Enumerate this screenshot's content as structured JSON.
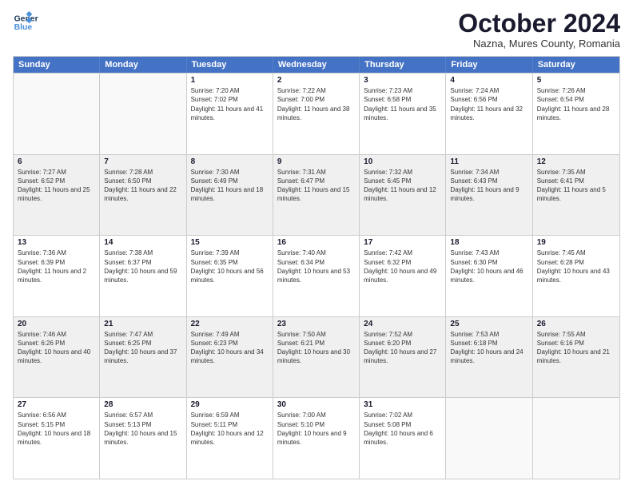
{
  "header": {
    "logo_line1": "General",
    "logo_line2": "Blue",
    "month": "October 2024",
    "location": "Nazna, Mures County, Romania"
  },
  "days_of_week": [
    "Sunday",
    "Monday",
    "Tuesday",
    "Wednesday",
    "Thursday",
    "Friday",
    "Saturday"
  ],
  "weeks": [
    [
      {
        "day": "",
        "info": ""
      },
      {
        "day": "",
        "info": ""
      },
      {
        "day": "1",
        "info": "Sunrise: 7:20 AM\nSunset: 7:02 PM\nDaylight: 11 hours and 41 minutes."
      },
      {
        "day": "2",
        "info": "Sunrise: 7:22 AM\nSunset: 7:00 PM\nDaylight: 11 hours and 38 minutes."
      },
      {
        "day": "3",
        "info": "Sunrise: 7:23 AM\nSunset: 6:58 PM\nDaylight: 11 hours and 35 minutes."
      },
      {
        "day": "4",
        "info": "Sunrise: 7:24 AM\nSunset: 6:56 PM\nDaylight: 11 hours and 32 minutes."
      },
      {
        "day": "5",
        "info": "Sunrise: 7:26 AM\nSunset: 6:54 PM\nDaylight: 11 hours and 28 minutes."
      }
    ],
    [
      {
        "day": "6",
        "info": "Sunrise: 7:27 AM\nSunset: 6:52 PM\nDaylight: 11 hours and 25 minutes."
      },
      {
        "day": "7",
        "info": "Sunrise: 7:28 AM\nSunset: 6:50 PM\nDaylight: 11 hours and 22 minutes."
      },
      {
        "day": "8",
        "info": "Sunrise: 7:30 AM\nSunset: 6:49 PM\nDaylight: 11 hours and 18 minutes."
      },
      {
        "day": "9",
        "info": "Sunrise: 7:31 AM\nSunset: 6:47 PM\nDaylight: 11 hours and 15 minutes."
      },
      {
        "day": "10",
        "info": "Sunrise: 7:32 AM\nSunset: 6:45 PM\nDaylight: 11 hours and 12 minutes."
      },
      {
        "day": "11",
        "info": "Sunrise: 7:34 AM\nSunset: 6:43 PM\nDaylight: 11 hours and 9 minutes."
      },
      {
        "day": "12",
        "info": "Sunrise: 7:35 AM\nSunset: 6:41 PM\nDaylight: 11 hours and 5 minutes."
      }
    ],
    [
      {
        "day": "13",
        "info": "Sunrise: 7:36 AM\nSunset: 6:39 PM\nDaylight: 11 hours and 2 minutes."
      },
      {
        "day": "14",
        "info": "Sunrise: 7:38 AM\nSunset: 6:37 PM\nDaylight: 10 hours and 59 minutes."
      },
      {
        "day": "15",
        "info": "Sunrise: 7:39 AM\nSunset: 6:35 PM\nDaylight: 10 hours and 56 minutes."
      },
      {
        "day": "16",
        "info": "Sunrise: 7:40 AM\nSunset: 6:34 PM\nDaylight: 10 hours and 53 minutes."
      },
      {
        "day": "17",
        "info": "Sunrise: 7:42 AM\nSunset: 6:32 PM\nDaylight: 10 hours and 49 minutes."
      },
      {
        "day": "18",
        "info": "Sunrise: 7:43 AM\nSunset: 6:30 PM\nDaylight: 10 hours and 46 minutes."
      },
      {
        "day": "19",
        "info": "Sunrise: 7:45 AM\nSunset: 6:28 PM\nDaylight: 10 hours and 43 minutes."
      }
    ],
    [
      {
        "day": "20",
        "info": "Sunrise: 7:46 AM\nSunset: 6:26 PM\nDaylight: 10 hours and 40 minutes."
      },
      {
        "day": "21",
        "info": "Sunrise: 7:47 AM\nSunset: 6:25 PM\nDaylight: 10 hours and 37 minutes."
      },
      {
        "day": "22",
        "info": "Sunrise: 7:49 AM\nSunset: 6:23 PM\nDaylight: 10 hours and 34 minutes."
      },
      {
        "day": "23",
        "info": "Sunrise: 7:50 AM\nSunset: 6:21 PM\nDaylight: 10 hours and 30 minutes."
      },
      {
        "day": "24",
        "info": "Sunrise: 7:52 AM\nSunset: 6:20 PM\nDaylight: 10 hours and 27 minutes."
      },
      {
        "day": "25",
        "info": "Sunrise: 7:53 AM\nSunset: 6:18 PM\nDaylight: 10 hours and 24 minutes."
      },
      {
        "day": "26",
        "info": "Sunrise: 7:55 AM\nSunset: 6:16 PM\nDaylight: 10 hours and 21 minutes."
      }
    ],
    [
      {
        "day": "27",
        "info": "Sunrise: 6:56 AM\nSunset: 5:15 PM\nDaylight: 10 hours and 18 minutes."
      },
      {
        "day": "28",
        "info": "Sunrise: 6:57 AM\nSunset: 5:13 PM\nDaylight: 10 hours and 15 minutes."
      },
      {
        "day": "29",
        "info": "Sunrise: 6:59 AM\nSunset: 5:11 PM\nDaylight: 10 hours and 12 minutes."
      },
      {
        "day": "30",
        "info": "Sunrise: 7:00 AM\nSunset: 5:10 PM\nDaylight: 10 hours and 9 minutes."
      },
      {
        "day": "31",
        "info": "Sunrise: 7:02 AM\nSunset: 5:08 PM\nDaylight: 10 hours and 6 minutes."
      },
      {
        "day": "",
        "info": ""
      },
      {
        "day": "",
        "info": ""
      }
    ]
  ]
}
